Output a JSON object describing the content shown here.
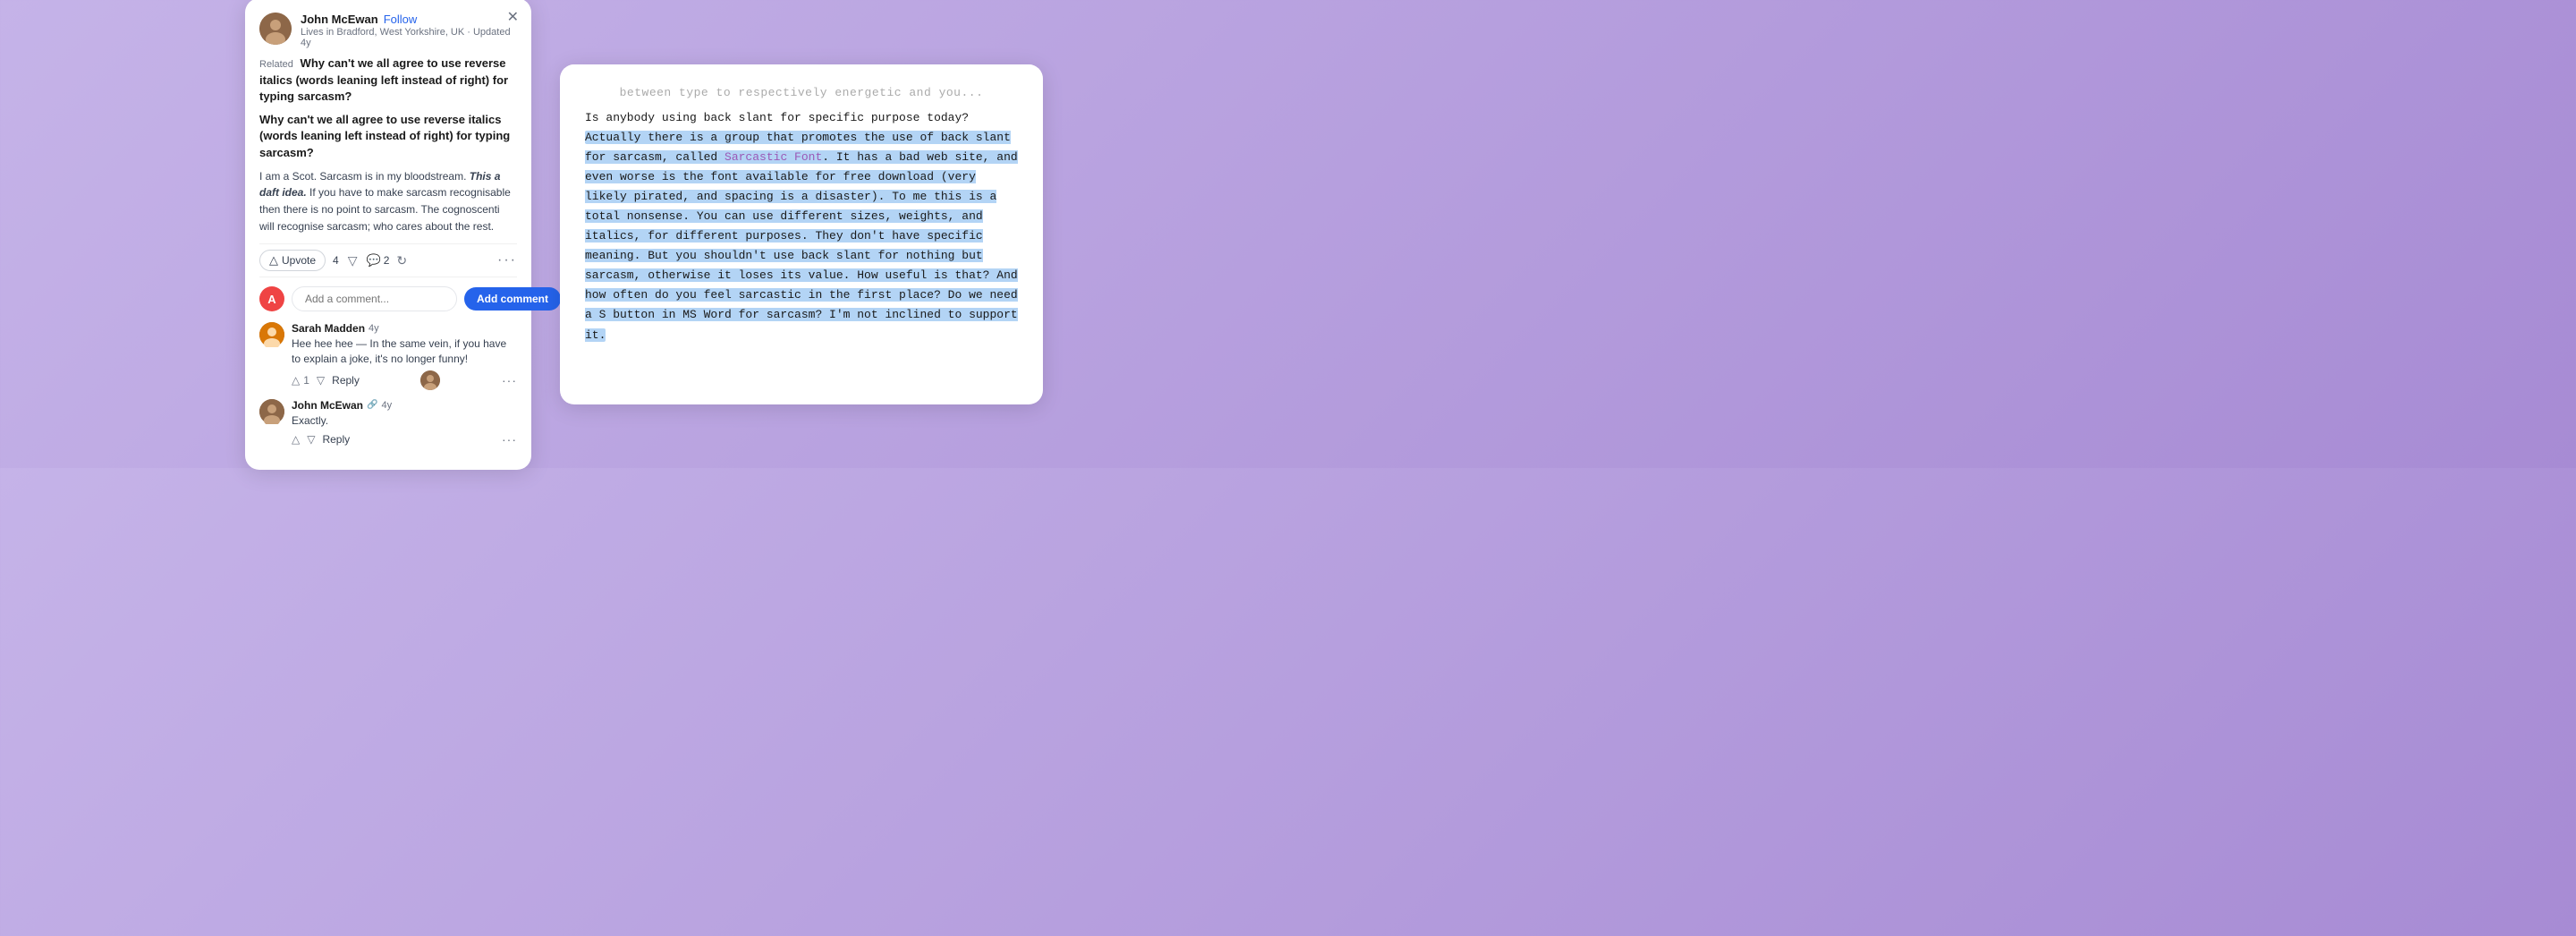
{
  "page": {
    "background_color": "#b39ddb"
  },
  "left_card": {
    "author": {
      "name": "John McEwan",
      "follow_label": "Follow",
      "meta": "Lives in Bradford, West Yorkshire, UK · Updated 4y"
    },
    "related_label": "Related",
    "related_question": "Why can't we all agree to use reverse italics (words leaning left instead of right) for typing sarcasm?",
    "main_question": "Why can't we all agree to use reverse italics (words leaning left instead of right) for typing sarcasm?",
    "answer_text_p1": "I am a Scot. Sarcasm is in my bloodstream.",
    "answer_emphasis": "This a daft idea.",
    "answer_text_p2": " If you have to make sarcasm recognisable then there is no point to sarcasm. The cognoscenti will recognise sarcasm; who cares about the rest.",
    "upvote_label": "Upvote",
    "upvote_count": "4",
    "comment_count": "2",
    "add_comment_placeholder": "Add a comment...",
    "add_comment_btn": "Add comment",
    "user_initial": "A",
    "comments": [
      {
        "author": "Sarah Madden",
        "time": "4y",
        "text": "Hee hee hee — In the same vein, if you have to explain a joke, it's no longer funny!",
        "upvote_count": "1",
        "reply_label": "Reply"
      },
      {
        "author": "John McEwan",
        "time": "4y",
        "text": "Exactly.",
        "reply_label": "Reply"
      }
    ]
  },
  "right_card": {
    "top_faded_text": "between type to respectively energetic and you...",
    "body_pre_highlight": "Is anybody using back slant for specific purpose today? ",
    "body_highlight": "Actually there is a group that promotes the use of back slant for sarcasm, called ",
    "sarcastic_font_link": "Sarcastic Font",
    "body_after_link": ". It has a bad web site, and even worse is the font available for free download (very likely pirated, and spacing is a disaster). To me this is a total nonsense. You can use different sizes, weights, and italics, for different purposes. They don't have specific meaning. But you shouldn't use back slant for nothing but sarcasm, otherwise it loses its value. How useful is that? And how often do you feel sarcastic in the first place? Do we need a S button in MS Word for sarcasm? I'm not inclined to support it.",
    "body_highlight_end": "it."
  }
}
